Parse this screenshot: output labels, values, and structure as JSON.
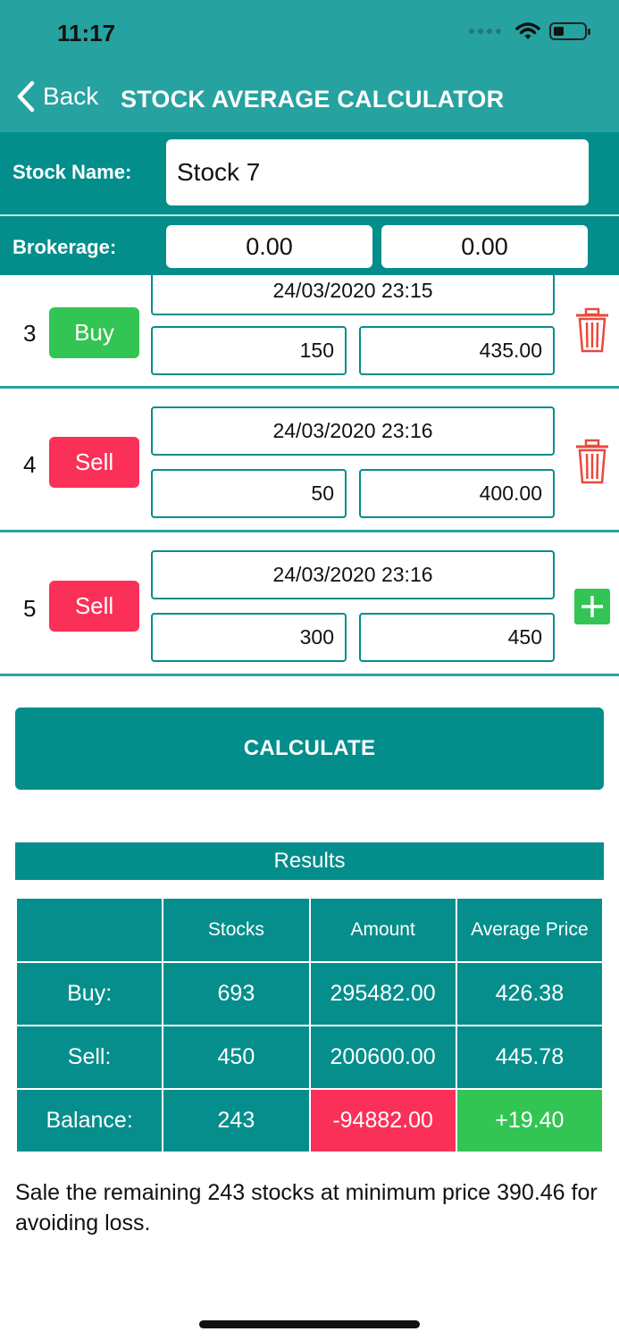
{
  "status": {
    "time": "11:17"
  },
  "nav": {
    "back_label": "Back",
    "title": "STOCK AVERAGE CALCULATOR"
  },
  "stock": {
    "name_label": "Stock Name:",
    "name_value": "Stock 7"
  },
  "brokerage": {
    "label": "Brokerage:",
    "buy": "0.00",
    "sell": "0.00"
  },
  "trades": [
    {
      "index": "3",
      "type": "Buy",
      "date": "24/03/2020 23:15",
      "qty": "150",
      "price": "435.00",
      "action": "trash-icon"
    },
    {
      "index": "4",
      "type": "Sell",
      "date": "24/03/2020 23:16",
      "qty": "50",
      "price": "400.00",
      "action": "trash-icon"
    },
    {
      "index": "5",
      "type": "Sell",
      "date": "24/03/2020 23:16",
      "qty": "300",
      "price": "450",
      "action": "plus-icon"
    }
  ],
  "calculate_label": "CALCULATE",
  "results": {
    "title": "Results",
    "headers": [
      "",
      "Stocks",
      "Amount",
      "Average Price"
    ],
    "rows": [
      [
        "Buy:",
        "693",
        "295482.00",
        "426.38"
      ],
      [
        "Sell:",
        "450",
        "200600.00",
        "445.78"
      ],
      [
        "Balance:",
        "243",
        "-94882.00",
        "+19.40"
      ]
    ]
  },
  "note": "Sale the remaining 243 stocks at minimum price 390.46 for avoiding loss.",
  "colors": {
    "header": "#26a2a0",
    "teal": "#038e8c",
    "buy": "#33c553",
    "sell": "#fb3059"
  }
}
